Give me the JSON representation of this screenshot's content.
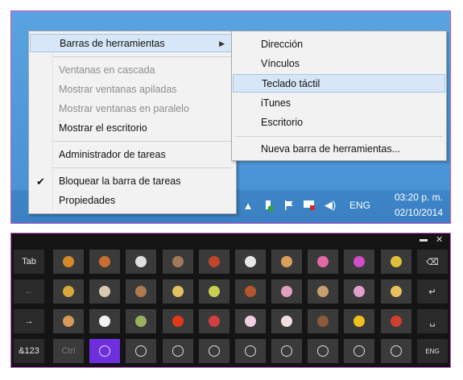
{
  "context_menu": {
    "items": [
      {
        "label": "Barras de herramientas",
        "state": "hover",
        "submenu": true
      },
      {
        "label": "Ventanas en cascada",
        "state": "disabled"
      },
      {
        "label": "Mostrar ventanas apiladas",
        "state": "disabled"
      },
      {
        "label": "Mostrar ventanas en paralelo",
        "state": "disabled"
      },
      {
        "label": "Mostrar el escritorio",
        "state": "normal"
      },
      {
        "label": "Administrador de tareas",
        "state": "normal"
      },
      {
        "label": "Bloquear la barra de tareas",
        "state": "checked"
      },
      {
        "label": "Propiedades",
        "state": "normal"
      }
    ],
    "check_glyph": "✔",
    "submenu_arrow": "▶"
  },
  "submenu": {
    "items": [
      {
        "label": "Dirección"
      },
      {
        "label": "Vínculos"
      },
      {
        "label": "Teclado táctil",
        "state": "hover"
      },
      {
        "label": "iTunes"
      },
      {
        "label": "Escritorio"
      },
      {
        "label": "Nueva barra de herramientas..."
      }
    ]
  },
  "taskbar": {
    "language": "ENG",
    "time": "03:20 p. m.",
    "date": "02/10/2014",
    "tray_icons": [
      "chevron-up-icon",
      "network-icon",
      "flag-icon",
      "monitor-icon",
      "speaker-icon"
    ]
  },
  "keyboard": {
    "title_buttons": {
      "minimize": "▬",
      "close": "✕"
    },
    "rows": [
      [
        "Tab",
        "pizza",
        "drumstick",
        "rice-bowl",
        "noodles",
        "candy",
        "sushi",
        "ice-cream",
        "donut",
        "lollipop",
        "pineapple",
        "⌫"
      ],
      [
        "←",
        "burger",
        "onigiri-dark",
        "plate",
        "croissant",
        "ice-pop",
        "meat",
        "drink",
        "cookie",
        "lolly",
        "cake",
        "↵"
      ],
      [
        "→",
        "sausage",
        "onigiri",
        "salad",
        "fries",
        "skewer",
        "layer-cake",
        "sundae",
        "chocolate",
        "bell",
        "bento",
        "␣"
      ],
      [
        "&123",
        "Ctrl",
        "smiley",
        "heart",
        "face",
        "flower",
        "planet",
        "plane",
        "car",
        "book",
        "clock",
        "ENG"
      ]
    ]
  }
}
